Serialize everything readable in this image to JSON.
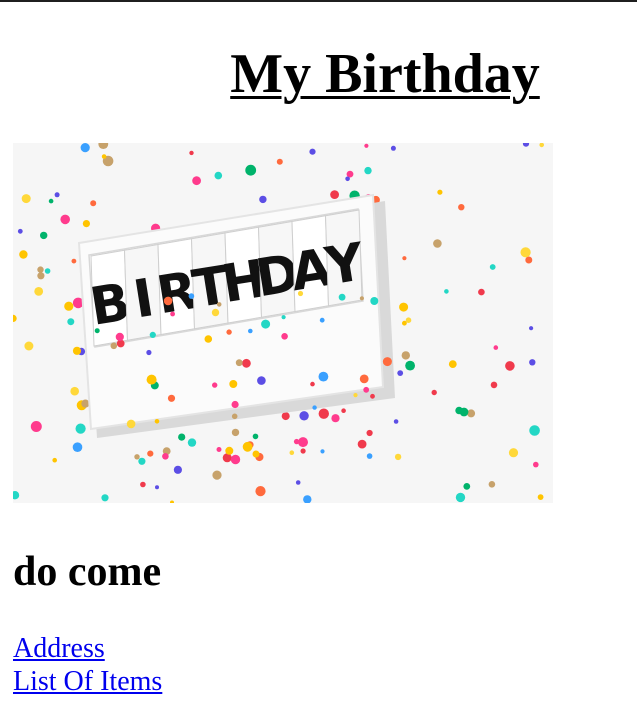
{
  "page": {
    "title": "My Birthday",
    "subheading": "do come"
  },
  "hero_image": {
    "sign_letters": [
      "B",
      "I",
      "R",
      "T",
      "H",
      "D",
      "A",
      "Y"
    ],
    "background_color": "#f6f6f6"
  },
  "links": [
    {
      "label": "Address"
    },
    {
      "label": "List Of Items"
    }
  ],
  "colors": {
    "link": "#0000ee",
    "text": "#000000",
    "confetti": [
      "#ffc400",
      "#ff3b8d",
      "#23d7c5",
      "#5c4ee5",
      "#ff6a3d",
      "#00b36b",
      "#ffd83a",
      "#f03a4c",
      "#3aa0ff",
      "#c7a26b"
    ]
  }
}
